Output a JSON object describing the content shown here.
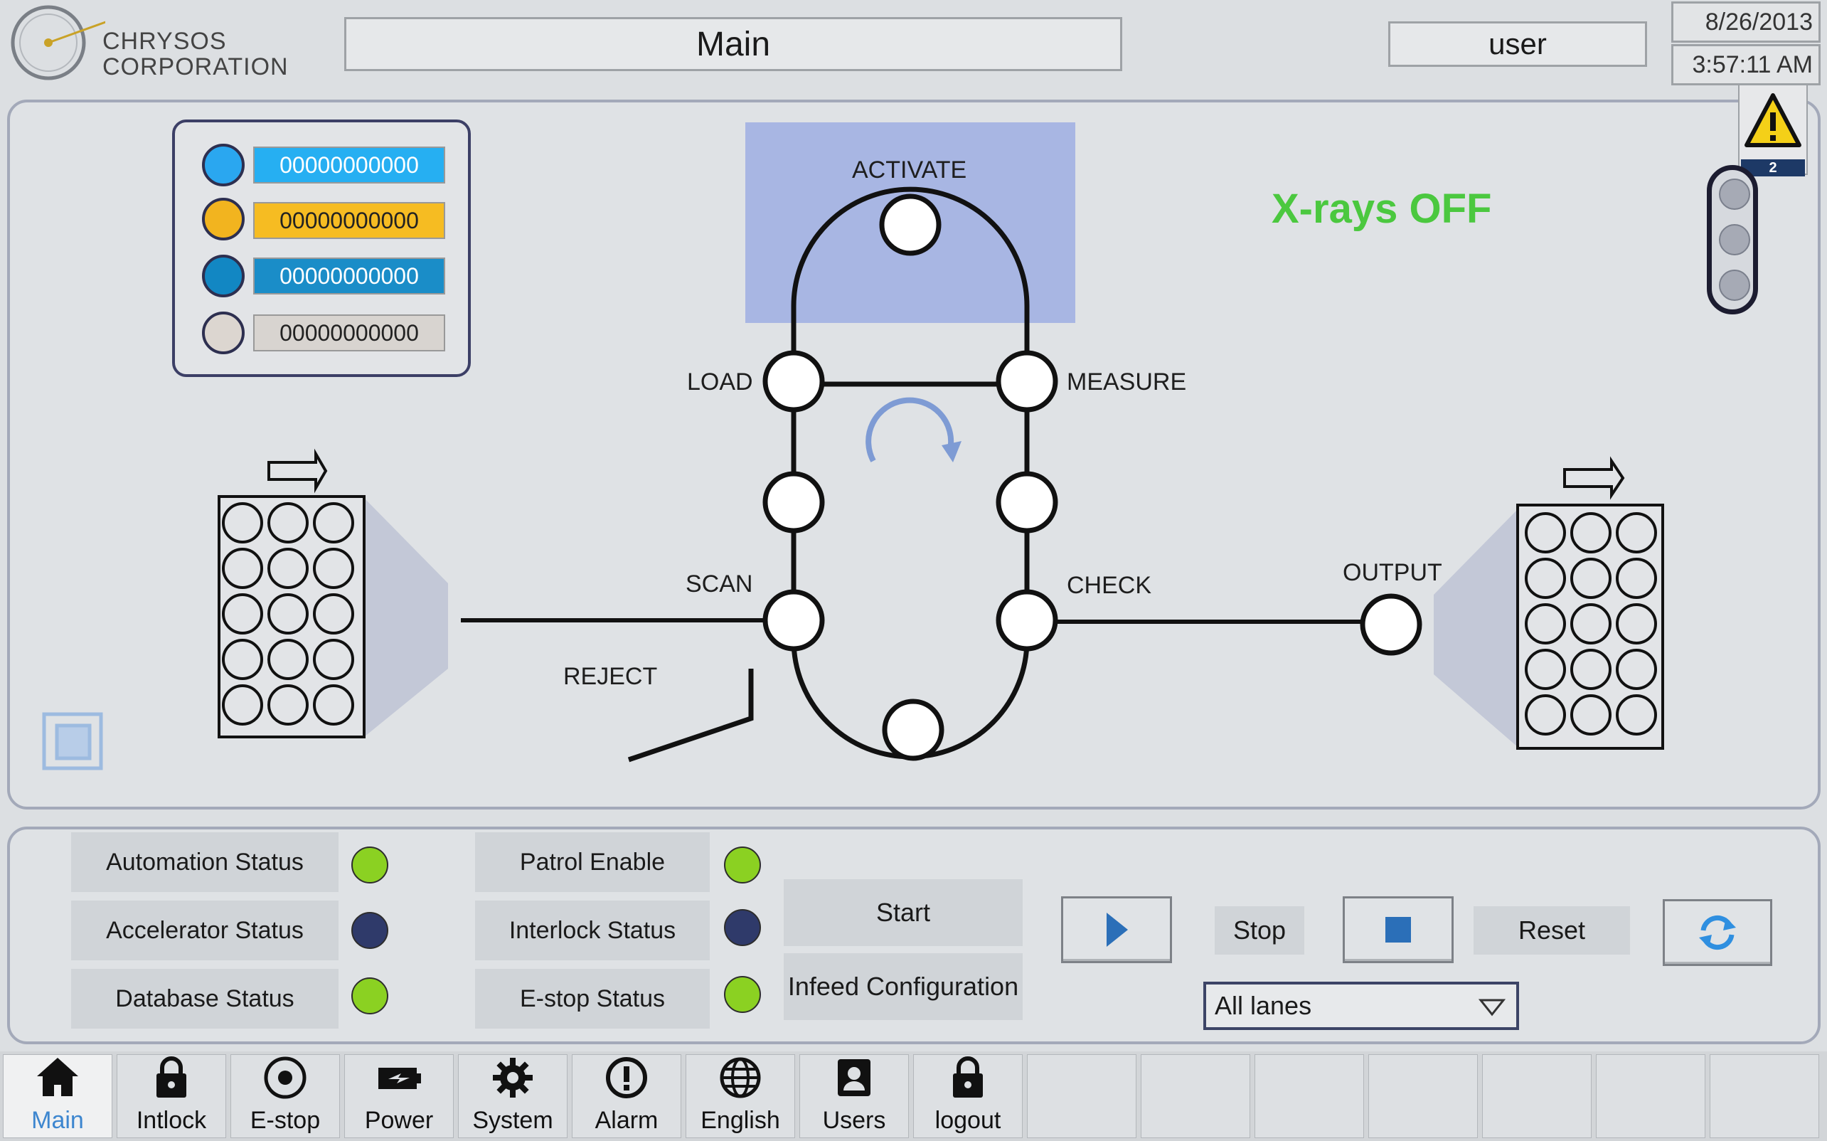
{
  "header": {
    "company_line1": "CHRYSOS",
    "company_line2": "CORPORATION",
    "screen_title": "Main",
    "user": "user",
    "date": "8/26/2013",
    "time": "3:57:11 AM"
  },
  "counters": [
    {
      "value": "00000000000",
      "dot_color": "#2aa7f0",
      "bar_color": "#26aff2",
      "text_color": "#ffffff"
    },
    {
      "value": "00000000000",
      "dot_color": "#f2b41f",
      "bar_color": "#f6bc22",
      "text_color": "#222222"
    },
    {
      "value": "00000000000",
      "dot_color": "#1287c3",
      "bar_color": "#1a8dc8",
      "text_color": "#ffffff"
    },
    {
      "value": "00000000000",
      "dot_color": "#dcd6d0",
      "bar_color": "#d8d4d0",
      "text_color": "#222222"
    }
  ],
  "process": {
    "stations": {
      "activate": "ACTIVATE",
      "load": "LOAD",
      "measure": "MEASURE",
      "scan": "SCAN",
      "check": "CHECK",
      "reject": "REJECT",
      "output": "OUTPUT"
    },
    "xrays_status": "X-rays OFF",
    "xrays_color": "#4bc83f"
  },
  "alarm": {
    "count": "2"
  },
  "status": {
    "automation": {
      "label": "Automation Status",
      "state": "green"
    },
    "accelerator": {
      "label": "Accelerator Status",
      "state": "navy"
    },
    "database": {
      "label": "Database Status",
      "state": "green"
    },
    "patrol": {
      "label": "Patrol Enable",
      "state": "green"
    },
    "interlock": {
      "label": "Interlock Status",
      "state": "navy"
    },
    "estop": {
      "label": "E-stop Status",
      "state": "green"
    }
  },
  "controls": {
    "start": "Start",
    "infeed_config": "Infeed Configuration",
    "stop": "Stop",
    "reset": "Reset",
    "lane_select": "All lanes"
  },
  "nav": [
    {
      "label": "Main",
      "icon": "home-icon",
      "active": true
    },
    {
      "label": "Intlock",
      "icon": "lock-icon",
      "active": false
    },
    {
      "label": "E-stop",
      "icon": "estop-icon",
      "active": false
    },
    {
      "label": "Power",
      "icon": "power-icon",
      "active": false
    },
    {
      "label": "System",
      "icon": "gear-icon",
      "active": false
    },
    {
      "label": "Alarm",
      "icon": "alarm-icon",
      "active": false
    },
    {
      "label": "English",
      "icon": "globe-icon",
      "active": false
    },
    {
      "label": "Users",
      "icon": "user-icon",
      "active": false
    },
    {
      "label": "logout",
      "icon": "lock-icon",
      "active": false
    }
  ]
}
